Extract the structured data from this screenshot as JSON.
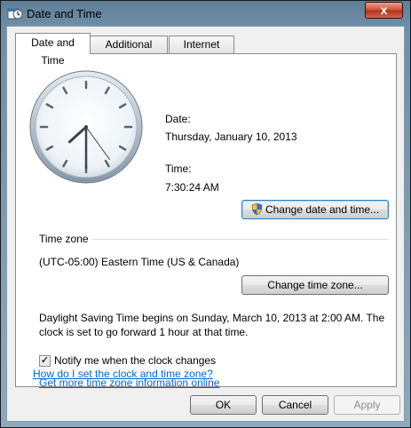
{
  "window": {
    "title": "Date and Time",
    "close_glyph": "x"
  },
  "tabs": [
    {
      "label": "Date and Time",
      "active": true
    },
    {
      "label": "Additional Clocks",
      "active": false
    },
    {
      "label": "Internet Time",
      "active": false
    }
  ],
  "date_section": {
    "date_label": "Date:",
    "date_value": "Thursday, January 10, 2013",
    "time_label": "Time:",
    "time_value": "7:30:24 AM",
    "change_datetime_button": "Change date and time...",
    "clock_icon": "analog-clock-icon"
  },
  "timezone_section": {
    "heading": "Time zone",
    "value": "(UTC-05:00) Eastern Time (US & Canada)",
    "change_button": "Change time zone..."
  },
  "dst": {
    "line1": "Daylight Saving Time begins on Sunday, March 10, 2013 at 2:00 AM. The",
    "line2": "clock is set to go forward 1 hour at that time."
  },
  "notify": {
    "label": "Notify me when the clock changes",
    "checked": true
  },
  "links": {
    "more_info": "Get more time zone information online",
    "how_to": "How do I set the clock and time zone?"
  },
  "footer": {
    "ok": "OK",
    "cancel": "Cancel",
    "apply": "Apply"
  }
}
